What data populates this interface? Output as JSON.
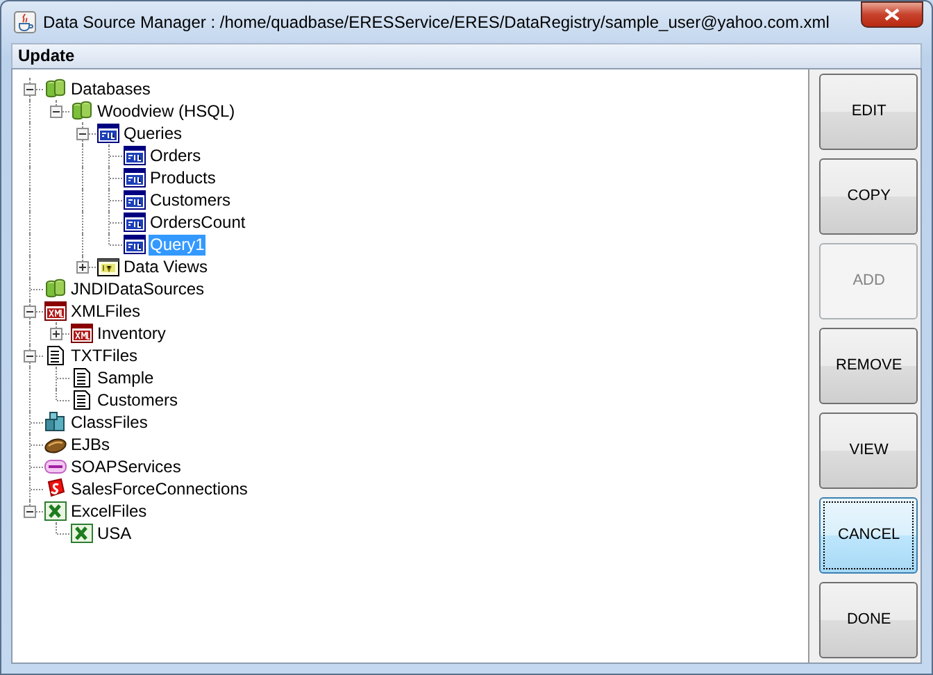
{
  "window": {
    "title": "Data Source Manager : /home/quadbase/ERESService/ERES/DataRegistry/sample_user@yahoo.com.xml"
  },
  "menu": [
    "Update"
  ],
  "tree": [
    {
      "label": "Databases",
      "kind": "database",
      "expanded": true,
      "selected": false,
      "children": [
        {
          "label": "Woodview (HSQL)",
          "kind": "database",
          "expanded": true,
          "selected": false,
          "children": [
            {
              "label": "Queries",
              "kind": "sql",
              "expanded": true,
              "selected": false,
              "children": [
                {
                  "label": "Orders",
                  "kind": "sql",
                  "selected": false
                },
                {
                  "label": "Products",
                  "kind": "sql",
                  "selected": false
                },
                {
                  "label": "Customers",
                  "kind": "sql",
                  "selected": false
                },
                {
                  "label": "OrdersCount",
                  "kind": "sql",
                  "selected": false
                },
                {
                  "label": "Query1",
                  "kind": "sql",
                  "selected": true
                }
              ]
            },
            {
              "label": "Data Views",
              "kind": "dataview",
              "expanded": false,
              "selected": false
            }
          ]
        }
      ]
    },
    {
      "label": "JNDIDataSources",
      "kind": "database",
      "selected": false
    },
    {
      "label": "XMLFiles",
      "kind": "xml",
      "expanded": true,
      "selected": false,
      "children": [
        {
          "label": "Inventory",
          "kind": "xml",
          "expanded": false,
          "selected": false
        }
      ]
    },
    {
      "label": "TXTFiles",
      "kind": "txt",
      "expanded": true,
      "selected": false,
      "children": [
        {
          "label": "Sample",
          "kind": "txt",
          "selected": false
        },
        {
          "label": "Customers",
          "kind": "txt",
          "selected": false
        }
      ]
    },
    {
      "label": "ClassFiles",
      "kind": "class",
      "selected": false
    },
    {
      "label": "EJBs",
      "kind": "ejb",
      "selected": false
    },
    {
      "label": "SOAPServices",
      "kind": "soap",
      "selected": false
    },
    {
      "label": "SalesForceConnections",
      "kind": "salesforce",
      "selected": false
    },
    {
      "label": "ExcelFiles",
      "kind": "excel",
      "expanded": true,
      "selected": false,
      "children": [
        {
          "label": "USA",
          "kind": "excel",
          "selected": false
        }
      ]
    }
  ],
  "buttons": [
    {
      "label": "EDIT",
      "disabled": false,
      "focused": false
    },
    {
      "label": "COPY",
      "disabled": false,
      "focused": false
    },
    {
      "label": "ADD",
      "disabled": true,
      "focused": false
    },
    {
      "label": "REMOVE",
      "disabled": false,
      "focused": false
    },
    {
      "label": "VIEW",
      "disabled": false,
      "focused": false
    },
    {
      "label": "CANCEL",
      "disabled": false,
      "focused": true
    },
    {
      "label": "DONE",
      "disabled": false,
      "focused": false
    }
  ]
}
